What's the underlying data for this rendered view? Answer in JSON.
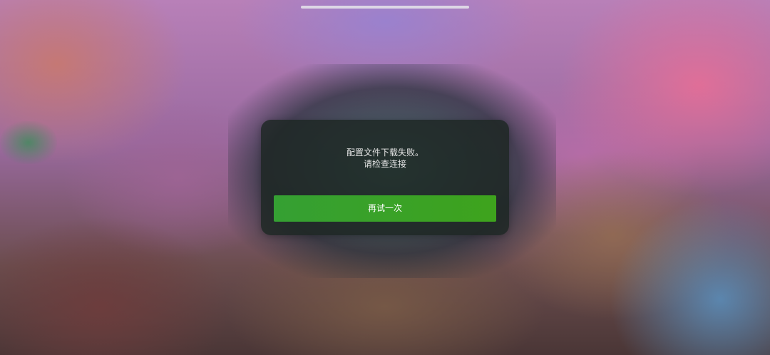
{
  "dialog": {
    "message_line1": "配置文件下载失败。",
    "message_line2": "请检查连接",
    "retry_label": "再试一次"
  },
  "colors": {
    "dialog_background": "#1c2622",
    "button_green": "#3ea31d",
    "text": "#e6e6e6"
  }
}
